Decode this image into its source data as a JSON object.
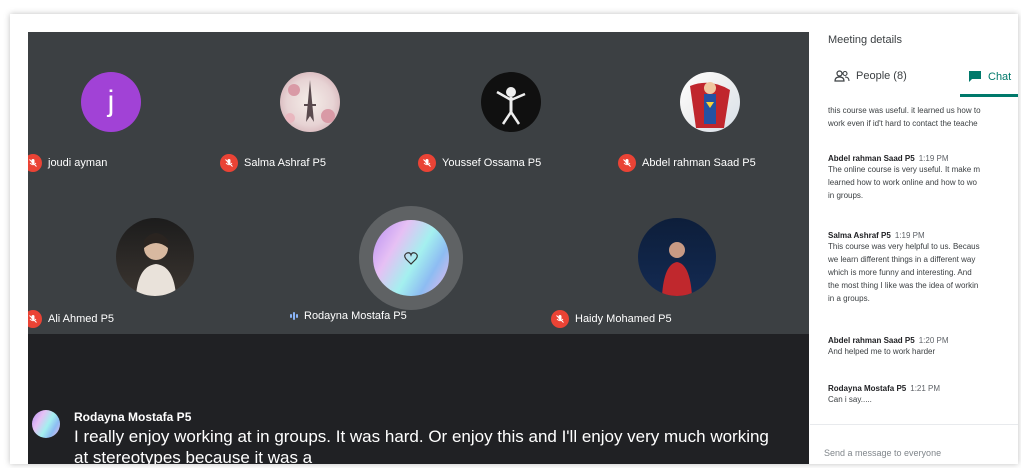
{
  "participants_grid": [
    {
      "name": "joudi ayman",
      "initial": "j",
      "muted": true
    },
    {
      "name": "Salma Ashraf P5",
      "muted": true
    },
    {
      "name": "Youssef Ossama P5",
      "muted": true
    },
    {
      "name": "Abdel rahman Saad P5",
      "muted": true
    },
    {
      "name": "Ali Ahmed P5",
      "muted": true
    },
    {
      "name": "Rodayna Mostafa P5",
      "muted": false,
      "speaking": true
    },
    {
      "name": "Haidy Mohamed P5",
      "muted": true
    }
  ],
  "caption": {
    "speaker": "Rodayna Mostafa P5",
    "text": "I really enjoy working at in groups. It was hard. Or enjoy this and I'll enjoy very much working at stereotypes because it was a"
  },
  "panel": {
    "title": "Meeting details",
    "tabs": {
      "people": "People (8)",
      "chat": "Chat"
    },
    "messages": [
      {
        "author": "",
        "time": "",
        "text": "this course was useful. it learned us how to\nwork even if id't hard to contact the teache"
      },
      {
        "author": "Abdel rahman Saad P5",
        "time": "1:19 PM",
        "text": "The online course is very useful. It make m\nlearned how to work online and how to wo\nin groups."
      },
      {
        "author": "Salma Ashraf P5",
        "time": "1:19 PM",
        "text": "This course was very helpful to us. Becaus\nwe learn different things in a different way\nwhich is more funny and interesting. And\nthe most thing I like was the idea of workin\nin a groups."
      },
      {
        "author": "Abdel rahman Saad P5",
        "time": "1:20 PM",
        "text": "And helped me to work harder"
      },
      {
        "author": "Rodayna Mostafa P5",
        "time": "1:21 PM",
        "text": "Can i say....."
      }
    ],
    "send_placeholder": "Send a message to everyone"
  },
  "colors": {
    "mute_red": "#ea4335",
    "chat_teal": "#00796b",
    "stage_bg": "#3c4043"
  },
  "icons": [
    "mic-off-icon",
    "people-icon",
    "chat-icon",
    "audio-level-icon",
    "heart-icon"
  ]
}
